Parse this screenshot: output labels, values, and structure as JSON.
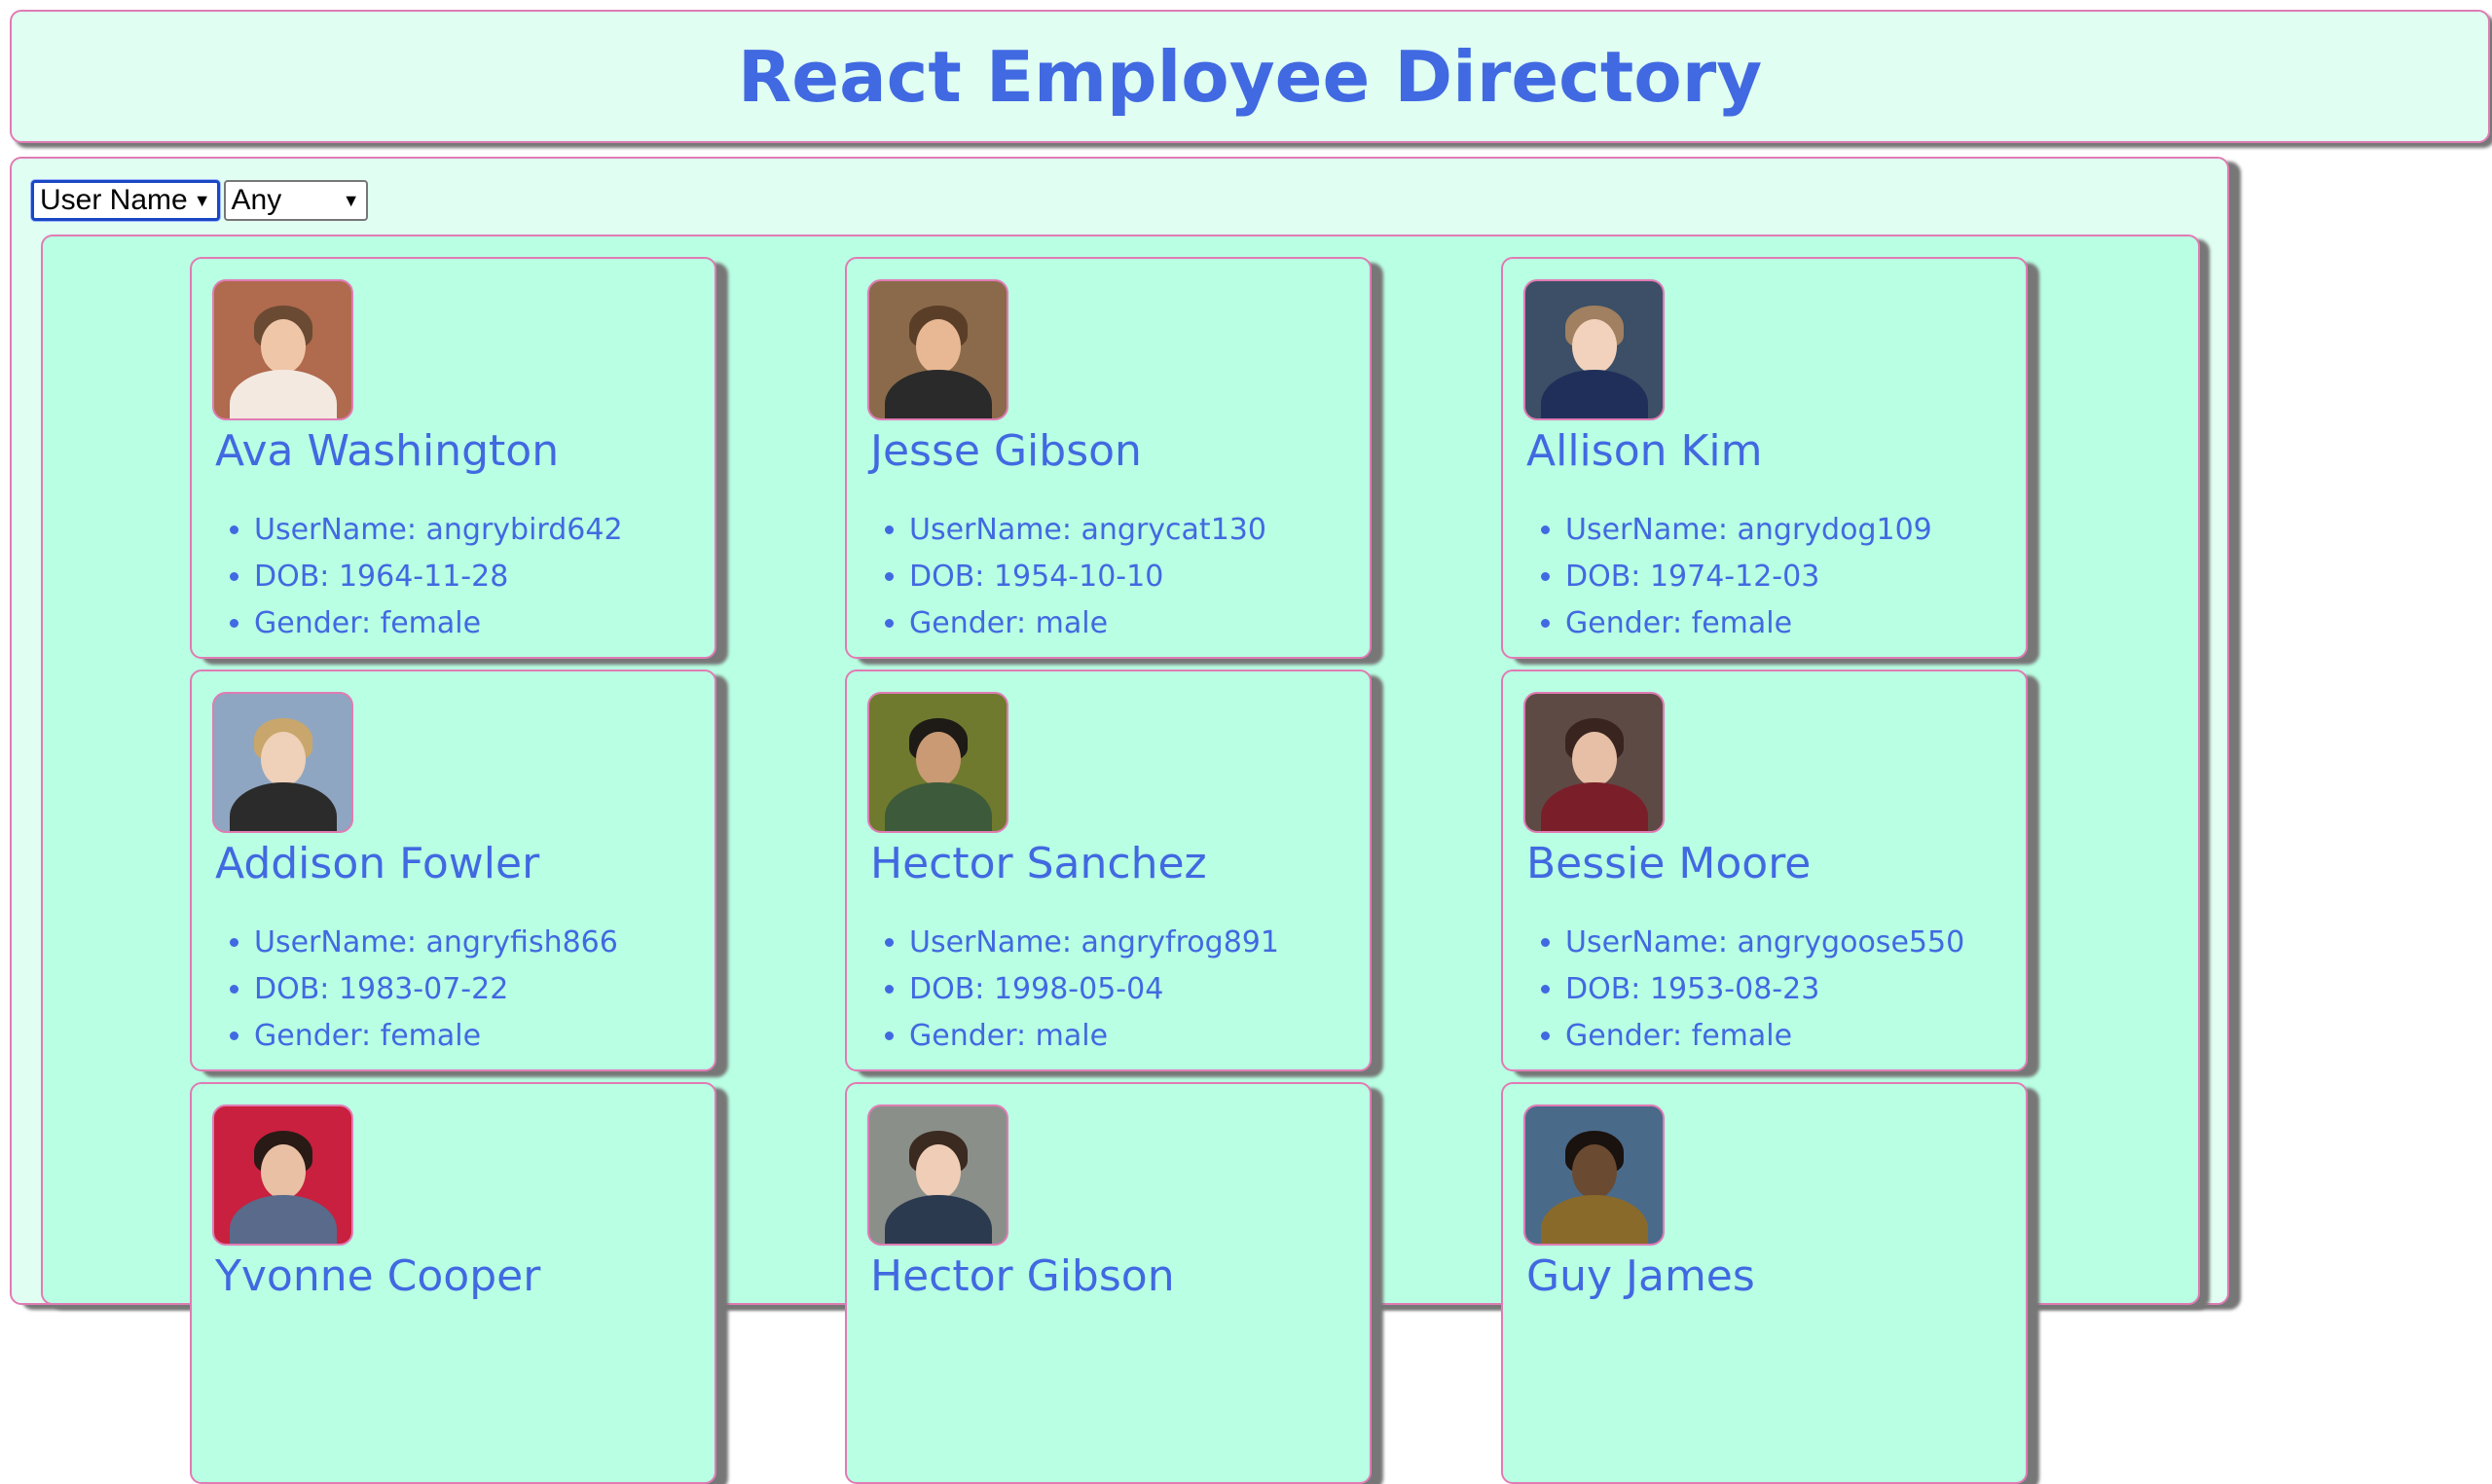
{
  "header": {
    "title": "React Employee Directory"
  },
  "controls": {
    "sort_field": "User Name",
    "filter_gender": "Any"
  },
  "employees": [
    {
      "name": "Ava Washington",
      "username": "UserName: angrybird642",
      "dob": "DOB: 1964-11-28",
      "gender": "Gender: female"
    },
    {
      "name": "Jesse Gibson",
      "username": "UserName: angrycat130",
      "dob": "DOB: 1954-10-10",
      "gender": "Gender: male"
    },
    {
      "name": "Allison Kim",
      "username": "UserName: angrydog109",
      "dob": "DOB: 1974-12-03",
      "gender": "Gender: female"
    },
    {
      "name": "Addison Fowler",
      "username": "UserName: angryfish866",
      "dob": "DOB: 1983-07-22",
      "gender": "Gender: female"
    },
    {
      "name": "Hector Sanchez",
      "username": "UserName: angryfrog891",
      "dob": "DOB: 1998-05-04",
      "gender": "Gender: male"
    },
    {
      "name": "Bessie Moore",
      "username": "UserName: angrygoose550",
      "dob": "DOB: 1953-08-23",
      "gender": "Gender: female"
    },
    {
      "name": "Yvonne Cooper",
      "username": "",
      "dob": "",
      "gender": ""
    },
    {
      "name": "Hector Gibson",
      "username": "",
      "dob": "",
      "gender": ""
    },
    {
      "name": "Guy James",
      "username": "",
      "dob": "",
      "gender": ""
    }
  ]
}
